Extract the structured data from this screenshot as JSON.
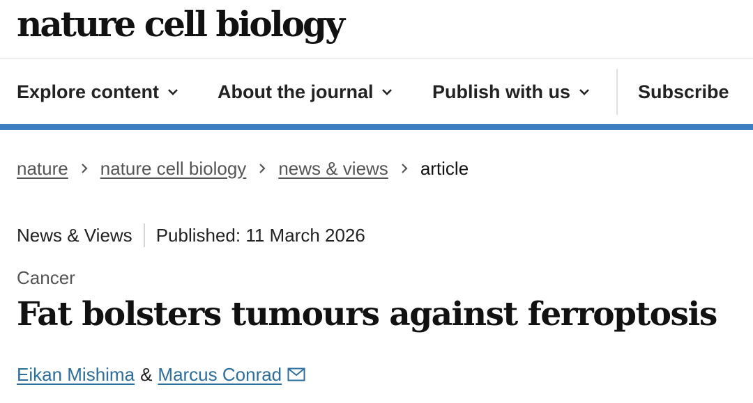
{
  "masthead": {
    "logo": "nature cell biology"
  },
  "nav": {
    "items": [
      {
        "label": "Explore content",
        "icon": "chevron-down-icon"
      },
      {
        "label": "About the journal",
        "icon": "chevron-down-icon"
      },
      {
        "label": "Publish with us",
        "icon": "chevron-down-icon"
      }
    ],
    "subscribe": "Subscribe",
    "accent_color": "#3f7ec1"
  },
  "breadcrumb": {
    "items": [
      "nature",
      "nature cell biology",
      "news & views"
    ],
    "current": "article",
    "separator_icon": "chevron-right-icon"
  },
  "article": {
    "type": "News & Views",
    "published": "Published: 11 March 2026",
    "subject": "Cancer",
    "title": "Fat bolsters tumours against ferroptosis",
    "authors": [
      "Eikan Mishima",
      "Marcus Conrad"
    ],
    "author_separator": "&",
    "contact_icon": "mail-icon",
    "link_color": "#2c6e9e"
  }
}
